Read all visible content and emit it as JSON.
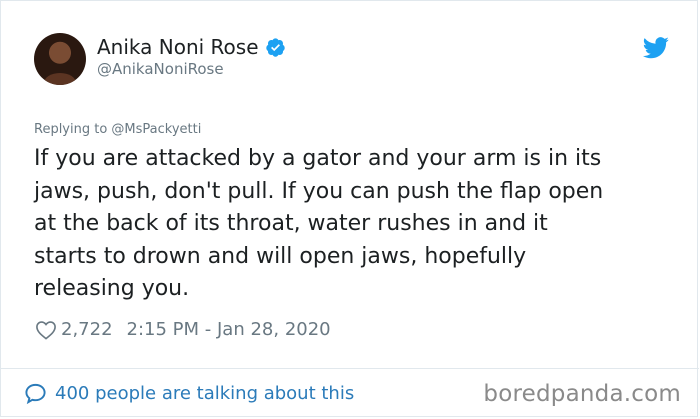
{
  "author": {
    "name": "Anika Noni Rose",
    "handle": "@AnikaNoniRose",
    "verified_icon": "verified-badge-icon"
  },
  "reply_to": "Replying to @MsPackyetti",
  "tweet": {
    "text": "If you are attacked by a gator and your arm is in its\njaws, push, don't pull. If you can push the flap open\nat the back of its throat, water rushes in and it\nstarts to drown and will open jaws, hopefully\nreleasing you."
  },
  "meta": {
    "likes": "2,722",
    "timestamp": "2:15 PM - Jan 28, 2020"
  },
  "footer": {
    "talking": "400 people are talking about this",
    "watermark": "boredpanda.com"
  },
  "colors": {
    "twitter_blue": "#1da1f2",
    "link_blue": "#2b7bb9",
    "muted_gray": "#697882"
  }
}
